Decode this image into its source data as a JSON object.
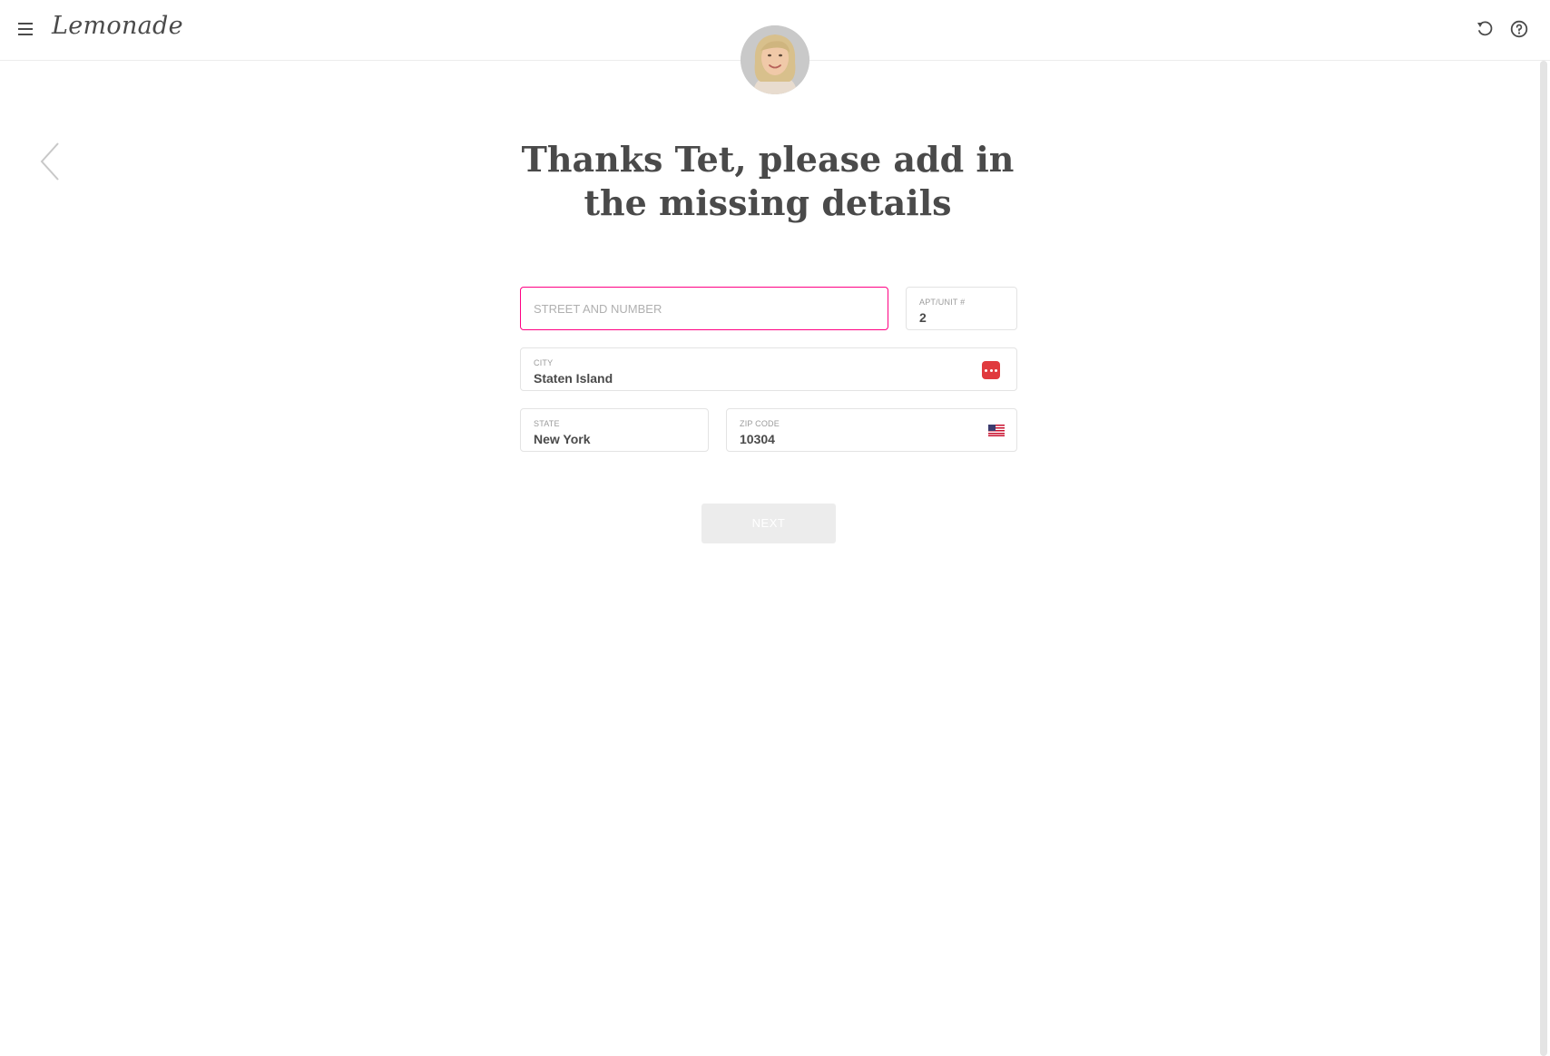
{
  "app": {
    "logo_text": "Lemonade"
  },
  "header": {
    "menu_icon": "hamburger-menu-icon",
    "undo_icon": "undo-icon",
    "help_icon": "help-circle-icon"
  },
  "main": {
    "title": "Thanks Tet, please add in the missing details",
    "back_icon": "chevron-left-icon"
  },
  "form": {
    "street": {
      "placeholder": "STREET AND NUMBER",
      "value": ""
    },
    "apt": {
      "label": "APT/UNIT #",
      "value": "2"
    },
    "city": {
      "label": "CITY",
      "value": "Staten Island",
      "icon": "password-manager-icon"
    },
    "state": {
      "label": "STATE",
      "value": "New York"
    },
    "zip": {
      "label": "ZIP CODE",
      "value": "10304",
      "icon": "us-flag-icon"
    }
  },
  "actions": {
    "next_label": "NEXT"
  },
  "colors": {
    "accent": "#ff0083",
    "text": "#4a4a4a",
    "disabled_button": "#ececec",
    "password_icon": "#e03a3e"
  }
}
